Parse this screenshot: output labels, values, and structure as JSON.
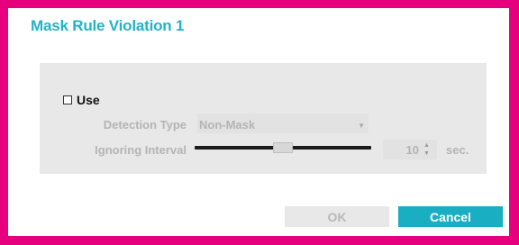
{
  "dialog": {
    "title": "Mask Rule Violation 1"
  },
  "settings": {
    "use": {
      "label": "Use",
      "checked": false
    },
    "detection_type": {
      "label": "Detection Type",
      "selected": "Non-Mask",
      "arrow_icon": "chevron-down-icon"
    },
    "ignoring_interval": {
      "label": "Ignoring Interval",
      "value": "10",
      "unit": "sec.",
      "slider_level": 0.5
    }
  },
  "buttons": {
    "ok_label": "OK",
    "cancel_label": "Cancel"
  },
  "colors": {
    "frame": "#e6007e",
    "accent": "#1aaec3",
    "title": "#22b3c7",
    "panel": "#e8e8e8",
    "disabled_text": "#b4b4b4"
  }
}
